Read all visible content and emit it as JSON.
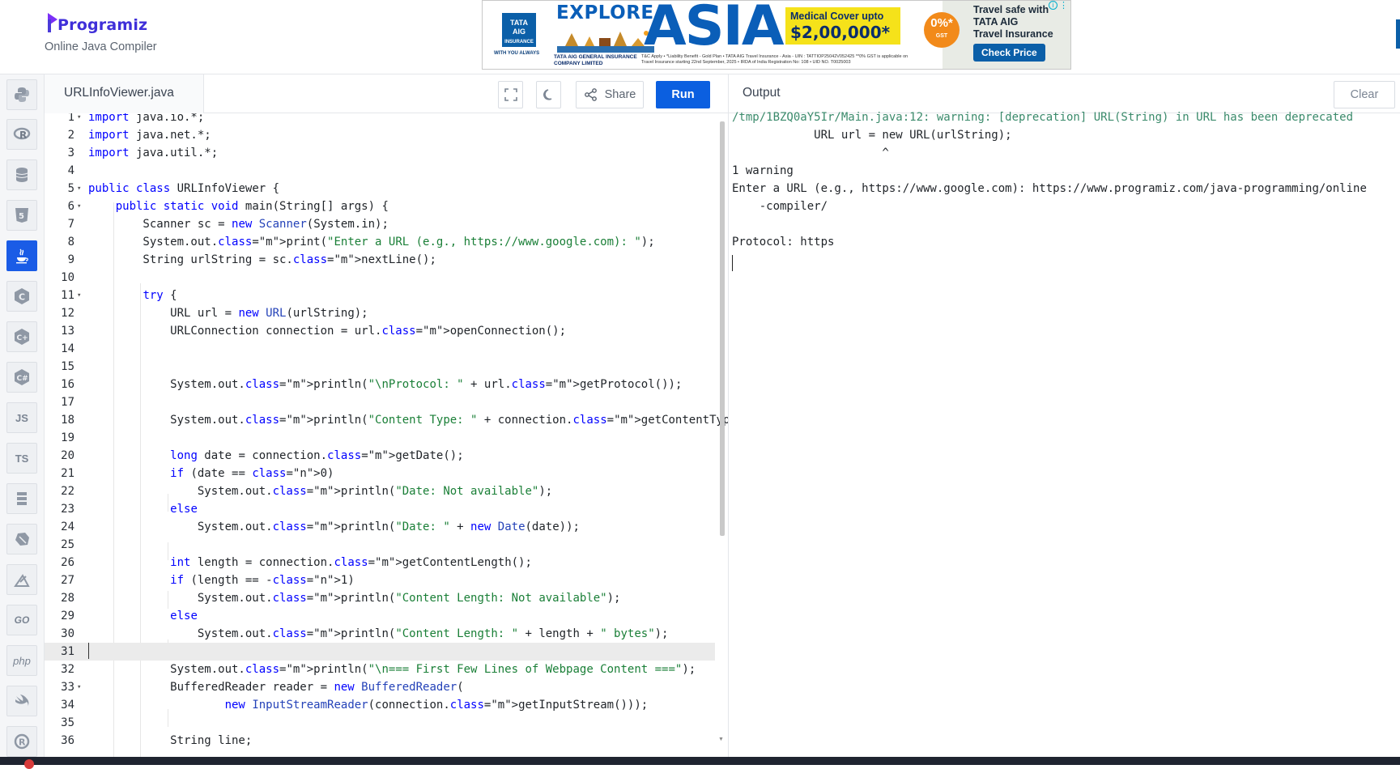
{
  "header": {
    "logo_text": "Programiz",
    "subtitle": "Online Java Compiler"
  },
  "ad": {
    "brand": "TATA AIG INSURANCE",
    "brand_tag": "WITH YOU ALWAYS",
    "explore": "EXPLORE",
    "asia": "ASIA",
    "medical_line1": "Medical Cover upto",
    "medical_line2": "$2,00,000*",
    "gst_value": "0%*",
    "gst_label": "GST",
    "right_line1": "Travel safe with",
    "right_line2": "TATA AIG",
    "right_line3": "Travel Insurance",
    "cta": "Check Price",
    "company": "TATA AIG GENERAL INSURANCE COMPANY LIMITED",
    "fine_print": "T&C Apply • *Liability Benefit - Gold Plan • TATA AIG Travel Insurance - Asia - UIN : TATTIOP25042V052425 **0% GST is applicable on Travel Insurance starting 22nd September, 2025 • IRDA of India Registration No: 108 • UID NO. T0025003"
  },
  "rail": {
    "items": [
      {
        "name": "python",
        "label": ""
      },
      {
        "name": "r",
        "label": ""
      },
      {
        "name": "sql",
        "label": ""
      },
      {
        "name": "html",
        "label": ""
      },
      {
        "name": "java",
        "label": ""
      },
      {
        "name": "c",
        "label": ""
      },
      {
        "name": "cpp",
        "label": ""
      },
      {
        "name": "csharp",
        "label": ""
      },
      {
        "name": "js",
        "label": "JS"
      },
      {
        "name": "ts",
        "label": "TS"
      },
      {
        "name": "swift",
        "label": ""
      },
      {
        "name": "dart",
        "label": ""
      },
      {
        "name": "kotlin",
        "label": ""
      },
      {
        "name": "go",
        "label": "GO"
      },
      {
        "name": "php",
        "label": "php"
      },
      {
        "name": "swift-2",
        "label": ""
      },
      {
        "name": "rust",
        "label": ""
      }
    ],
    "active": "java"
  },
  "editor": {
    "filename": "URLInfoViewer.java",
    "share_label": "Share",
    "run_label": "Run",
    "highlighted_line": 31,
    "lines": [
      "import java.io.*;",
      "import java.net.*;",
      "import java.util.*;",
      "",
      "public class URLInfoViewer {",
      "    public static void main(String[] args) {",
      "        Scanner sc = new Scanner(System.in);",
      "        System.out.print(\"Enter a URL (e.g., https://www.google.com): \");",
      "        String urlString = sc.nextLine();",
      "",
      "        try {",
      "            URL url = new URL(urlString);",
      "            URLConnection connection = url.openConnection();",
      "",
      "",
      "            System.out.println(\"\\nProtocol: \" + url.getProtocol());",
      "",
      "            System.out.println(\"Content Type: \" + connection.getContentType());",
      "",
      "            long date = connection.getDate();",
      "            if (date == 0)",
      "                System.out.println(\"Date: Not available\");",
      "            else",
      "                System.out.println(\"Date: \" + new Date(date));",
      "",
      "            int length = connection.getContentLength();",
      "            if (length == -1)",
      "                System.out.println(\"Content Length: Not available\");",
      "            else",
      "                System.out.println(\"Content Length: \" + length + \" bytes\");",
      "",
      "            System.out.println(\"\\n=== First Few Lines of Webpage Content ===\");",
      "            BufferedReader reader = new BufferedReader(",
      "                    new InputStreamReader(connection.getInputStream()));",
      "",
      "            String line;"
    ]
  },
  "output": {
    "title": "Output",
    "clear_label": "Clear",
    "lines": [
      "/tmp/1BZQ0aY5Ir/Main.java:12: warning: [deprecation] URL(String) in URL has been deprecated",
      "            URL url = new URL(urlString);",
      "                      ^",
      "1 warning",
      "Enter a URL (e.g., https://www.google.com): https://www.programiz.com/java-programming/online",
      "    -compiler/",
      "",
      "Protocol: https"
    ]
  }
}
